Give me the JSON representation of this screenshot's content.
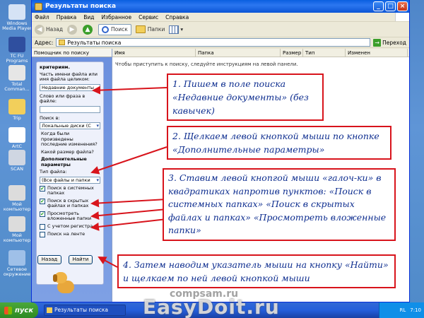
{
  "desktop": {
    "icons": [
      {
        "label": "Windows Media Player"
      },
      {
        "label": "TC FU Programs"
      },
      {
        "label": "Total Comman..."
      },
      {
        "label": "Trip"
      },
      {
        "label": "ArtC"
      },
      {
        "label": "SCAN"
      },
      {
        "label": "Мой компьютер"
      },
      {
        "label": "Мой компьютер"
      },
      {
        "label": "Сетевое окружение"
      }
    ]
  },
  "window": {
    "title": "Результаты поиска",
    "menu": [
      "Файл",
      "Правка",
      "Вид",
      "Избранное",
      "Сервис",
      "Справка"
    ],
    "toolbar": {
      "back": "Назад",
      "search": "Поиск",
      "folders": "Папки"
    },
    "address": {
      "label": "Адрес:",
      "value": "Результаты поиска",
      "go": "Переход"
    }
  },
  "left_pane": {
    "header": "Помощник по поиску",
    "criteria_label": "критериям.",
    "name_label": "Часть имени файла или имя файла целиком:",
    "name_value": "Недавние документы",
    "phrase_label": "Слово или фраза в файле:",
    "search_in_label": "Поиск в:",
    "search_in_value": "Локальные диски (C",
    "when_modified": "Когда были произведены последние изменения?",
    "size": "Какой размер файла?",
    "advanced": "Дополнительные параметры",
    "file_type_label": "Тип файла:",
    "file_type_value": "(Все файлы и папки",
    "checkboxes": [
      {
        "label": "Поиск в системных папках",
        "checked": true
      },
      {
        "label": "Поиск в скрытых файлах и папках",
        "checked": true
      },
      {
        "label": "Просмотреть вложенные папки",
        "checked": true
      },
      {
        "label": "С учетом регистра",
        "checked": false
      },
      {
        "label": "Поиск на ленте",
        "checked": false
      }
    ],
    "back_button": "Назад",
    "find_button": "Найти"
  },
  "results": {
    "columns": [
      "Имя",
      "Папка",
      "Размер",
      "Тип",
      "Изменен"
    ],
    "empty_message": "Чтобы приступить к поиску, следуйте инструкциям на левой панели."
  },
  "taskbar": {
    "start": "пуск",
    "task": "Результаты поиска",
    "lang": "RL",
    "time": "7:10"
  },
  "annotations": [
    {
      "text": "1. Пишем в поле поиска «Недавние документы» (без кавычек)"
    },
    {
      "text": "2. Щелкаем левой кнопкой мыши по кнопке «Дополнительные параметры»"
    },
    {
      "text": "3. Ставим левой кнопгой мыши «галоч-ки» в квадратиках напротив пунктов: «Поиск в системных папках» «Поиск в скрытых файлах и папках» «Просмотреть вложенные папки»"
    },
    {
      "text": "4. Затем наводим указатель мыши на кнопку «Найти» и щелкаем по ней левой кнопкой мыши"
    }
  ],
  "watermarks": {
    "small": "compsam.ru",
    "large": "EasyDoit.ru"
  },
  "colors": {
    "callout_border": "#d8141c",
    "callout_text": "#0d2d8f",
    "arrow": "#d8141c"
  }
}
